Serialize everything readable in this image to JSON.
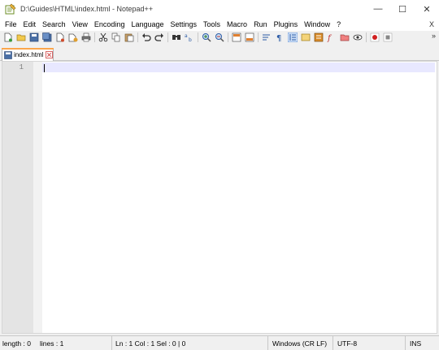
{
  "window": {
    "title": "D:\\Guides\\HTML\\index.html - Notepad++",
    "minimize_glyph": "—",
    "maximize_glyph": "☐",
    "close_glyph": "✕"
  },
  "menu": {
    "items": [
      "File",
      "Edit",
      "Search",
      "View",
      "Encoding",
      "Language",
      "Settings",
      "Tools",
      "Macro",
      "Run",
      "Plugins",
      "Window",
      "?"
    ],
    "close_glyph": "X"
  },
  "toolbar": {
    "icons": [
      "new-file-icon",
      "open-file-icon",
      "save-icon",
      "save-all-icon",
      "close-icon",
      "close-all-icon",
      "print-icon",
      "cut-icon",
      "copy-icon",
      "paste-icon",
      "undo-icon",
      "redo-icon",
      "find-icon",
      "replace-icon",
      "zoom-in-icon",
      "zoom-out-icon",
      "sync-vertical-icon",
      "sync-horizontal-icon",
      "word-wrap-icon",
      "show-all-chars-icon",
      "indent-guide-icon",
      "user-defined-language-icon",
      "document-map-icon",
      "function-list-icon",
      "folder-as-workspace-icon",
      "monitoring-icon",
      "record-macro-icon",
      "stop-recording-icon"
    ],
    "more_glyph": "»"
  },
  "tab": {
    "label": "index.html"
  },
  "editor": {
    "line_numbers": [
      "1"
    ],
    "content": ""
  },
  "status": {
    "length": "length : 0",
    "lines": "lines : 1",
    "position": "Ln : 1    Col : 1    Sel : 0 | 0",
    "eol": "Windows (CR LF)",
    "encoding": "UTF-8",
    "mode": "INS"
  },
  "colors": {
    "current_line": "#e8e8ff",
    "gutter": "#e4e4e4",
    "tab_accent": "#fba64c"
  }
}
